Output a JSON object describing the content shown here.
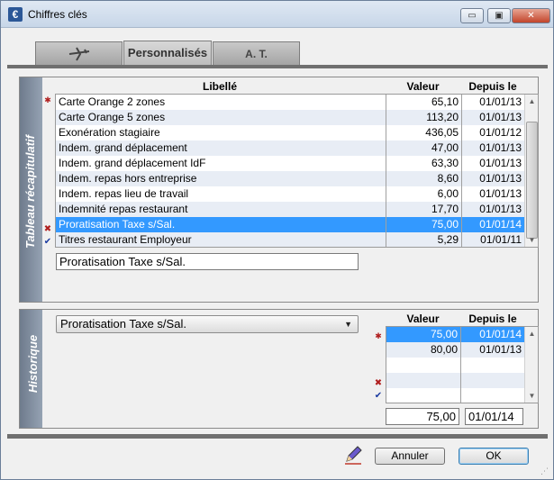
{
  "window": {
    "title": "Chiffres clés",
    "minimize_glyph": "▭",
    "maximize_glyph": "▣",
    "close_glyph": "✕",
    "app_icon_glyph": "€"
  },
  "tabs": [
    {
      "label": "",
      "icon": "plane-icon"
    },
    {
      "label": "Personnalisés"
    },
    {
      "label": "A. T."
    }
  ],
  "summary": {
    "side_label": "Tableau récapitulatif",
    "headers": {
      "libelle": "Libellé",
      "valeur": "Valeur",
      "depuis": "Depuis le"
    },
    "rows": [
      {
        "libelle": "Carte Orange 2 zones",
        "valeur": "65,10",
        "depuis": "01/01/13"
      },
      {
        "libelle": "Carte Orange 5 zones",
        "valeur": "113,20",
        "depuis": "01/01/13"
      },
      {
        "libelle": "Exonération stagiaire",
        "valeur": "436,05",
        "depuis": "01/01/12"
      },
      {
        "libelle": "Indem. grand déplacement",
        "valeur": "47,00",
        "depuis": "01/01/13"
      },
      {
        "libelle": "Indem. grand déplacement IdF",
        "valeur": "63,30",
        "depuis": "01/01/13"
      },
      {
        "libelle": "Indem. repas hors entreprise",
        "valeur": "8,60",
        "depuis": "01/01/13"
      },
      {
        "libelle": "Indem. repas lieu de travail",
        "valeur": "6,00",
        "depuis": "01/01/13"
      },
      {
        "libelle": "Indemnité repas restaurant",
        "valeur": "17,70",
        "depuis": "01/01/13"
      },
      {
        "libelle": "Proratisation Taxe s/Sal.",
        "valeur": "75,00",
        "depuis": "01/01/14"
      },
      {
        "libelle": "Titres restaurant Employeur",
        "valeur": "5,29",
        "depuis": "01/01/11"
      }
    ],
    "selected_index": 8,
    "edit_value": "Proratisation Taxe s/Sal."
  },
  "history": {
    "side_label": "Historique",
    "combo_value": "Proratisation Taxe s/Sal.",
    "headers": {
      "valeur": "Valeur",
      "depuis": "Depuis le"
    },
    "rows": [
      {
        "valeur": "75,00",
        "depuis": "01/01/14"
      },
      {
        "valeur": "80,00",
        "depuis": "01/01/13"
      },
      {
        "valeur": "",
        "depuis": ""
      },
      {
        "valeur": "",
        "depuis": ""
      },
      {
        "valeur": "",
        "depuis": ""
      }
    ],
    "edit_valeur": "75,00",
    "edit_depuis": "01/01/14"
  },
  "buttons": {
    "cancel": "Annuler",
    "ok": "OK"
  },
  "marks": {
    "star": "✱",
    "delete": "✖",
    "validate": "✔"
  },
  "scroll_glyphs": {
    "up": "▲",
    "down": "▼"
  },
  "combo_arrow": "▼",
  "grip_glyph": "⋰",
  "colors": {
    "selection": "#3399ff",
    "side_panel": "#7f8c9d",
    "accent_red": "#b01e1e",
    "accent_blue": "#1a3aa0"
  }
}
